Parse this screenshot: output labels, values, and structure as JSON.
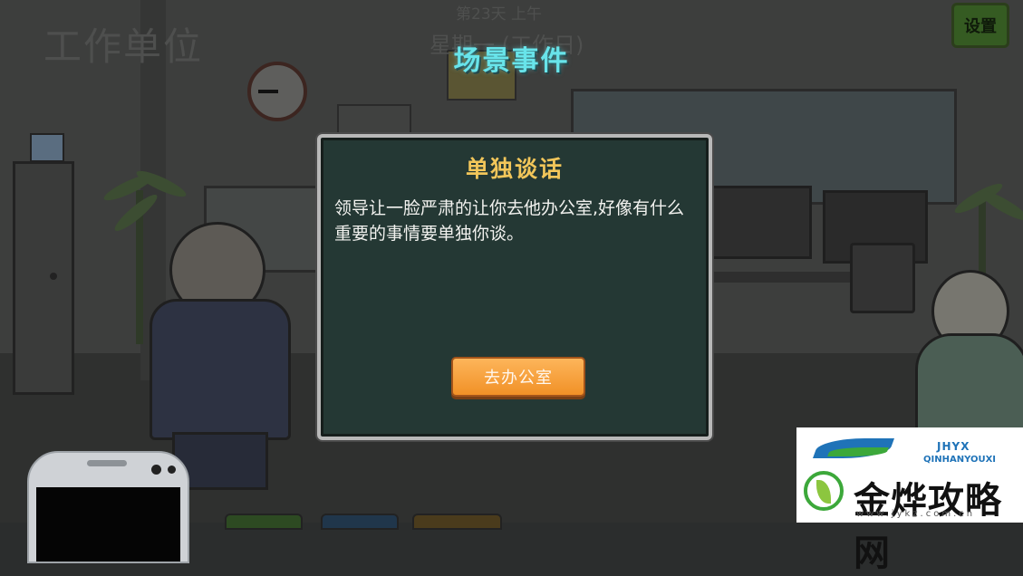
{
  "hud": {
    "location": "工作单位",
    "day": "第23天 上午",
    "weekday": "星期一 (工作日)",
    "settings_label": "设置"
  },
  "event": {
    "header": "场景事件",
    "title": "单独谈话",
    "description": "领导让一脸严肃的让你去他办公室,好像有什么重要的事情要单独你谈。",
    "action_label": "去办公室"
  },
  "watermark": {
    "tag": "JHYX",
    "tag_sub": "QINHANYOUXI",
    "site_name": "金烨攻略网",
    "site_url": "www.jykz.com.cn"
  },
  "colors": {
    "event_header": "#68e4ea",
    "dialog_title": "#f2c65a",
    "dialog_bg": "#243834",
    "action_button": "#f19127",
    "settings_button": "#355b22"
  }
}
